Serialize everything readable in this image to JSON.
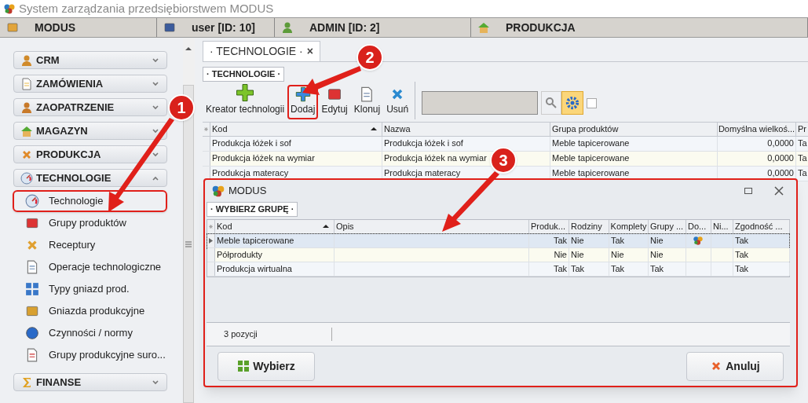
{
  "window": {
    "title": "System zarządzania przedsiębiorstwem MODUS"
  },
  "header": [
    {
      "label": "MODUS"
    },
    {
      "label": "user [ID: 10]"
    },
    {
      "label": "ADMIN [ID: 2]"
    },
    {
      "label": "PRODUKCJA"
    }
  ],
  "sidebar": {
    "groups": [
      {
        "label": "CRM",
        "expanded": false
      },
      {
        "label": "ZAMÓWIENIA",
        "expanded": false
      },
      {
        "label": "ZAOPATRZENIE",
        "expanded": false
      },
      {
        "label": "MAGAZYN",
        "expanded": false
      },
      {
        "label": "PRODUKCJA",
        "expanded": false
      },
      {
        "label": "TECHNOLOGIE",
        "expanded": true,
        "children": [
          {
            "label": "Technologie",
            "highlighted": true
          },
          {
            "label": "Grupy produktów",
            "highlighted": false
          },
          {
            "label": "Receptury",
            "highlighted": false
          },
          {
            "label": "Operacje technologiczne",
            "highlighted": false
          },
          {
            "label": "Typy gniazd prod.",
            "highlighted": false
          },
          {
            "label": "Gniazda produkcyjne",
            "highlighted": false
          },
          {
            "label": "Czynności / normy",
            "highlighted": false
          },
          {
            "label": "Grupy produkcyjne suro...",
            "highlighted": false
          }
        ]
      },
      {
        "label": "FINANSE",
        "expanded": false
      }
    ]
  },
  "tabs": [
    {
      "label": "· TECHNOLOGIE ·",
      "selected": true,
      "close": "×"
    }
  ],
  "panel": {
    "title": "· TECHNOLOGIE ·",
    "toolbar": [
      {
        "label": "Kreator technologii",
        "highlighted": false
      },
      {
        "label": "Dodaj",
        "highlighted": true
      },
      {
        "label": "Edytuj",
        "highlighted": false
      },
      {
        "label": "Klonuj",
        "highlighted": false
      },
      {
        "label": "Usuń",
        "highlighted": false
      }
    ],
    "filter_checkbox": {
      "checked": false
    },
    "table": {
      "columns": [
        "Kod",
        "Nazwa",
        "Grupa produktów",
        "Domyślna wielkoś...",
        "Pr"
      ],
      "rows": [
        [
          "Produkcja łóżek i sof",
          "Produkcja łóżek i sof",
          "Meble tapicerowane",
          "0,0000",
          "Ta"
        ],
        [
          "Produkcja łóżek na wymiar",
          "Produkcja łóżek na wymiar",
          "Meble tapicerowane",
          "0,0000",
          "Ta"
        ],
        [
          "Produkcja materacy",
          "Produkcja materacy",
          "Meble tapicerowane",
          "0,0000",
          "Ta"
        ]
      ]
    }
  },
  "dialog": {
    "title": "MODUS",
    "subtitle": "· WYBIERZ GRUPĘ ·",
    "columns": [
      "Kod",
      "Opis",
      "Produk...",
      "Rodziny",
      "Komplety",
      "Grupy ...",
      "Do...",
      "Ni...",
      "Zgodność ..."
    ],
    "rows": [
      {
        "selected": true,
        "icon": true,
        "cells": [
          "Meble tapicerowane",
          "",
          "Tak",
          "Nie",
          "Tak",
          "Nie",
          "",
          "",
          "Tak"
        ]
      },
      {
        "selected": false,
        "icon": false,
        "cells": [
          "Półprodukty",
          "",
          "Nie",
          "Nie",
          "Nie",
          "Nie",
          "",
          "",
          "Tak"
        ]
      },
      {
        "selected": false,
        "icon": false,
        "cells": [
          "Produkcja wirtualna",
          "",
          "Tak",
          "Tak",
          "Tak",
          "Tak",
          "",
          "",
          "Tak"
        ]
      }
    ],
    "status": "3 pozycji",
    "buttons": [
      {
        "label": "Wybierz",
        "kind": "ok"
      },
      {
        "label": "Anuluj",
        "kind": "cancel"
      }
    ]
  },
  "annotations": [
    {
      "label": "1"
    },
    {
      "label": "2"
    },
    {
      "label": "3"
    }
  ]
}
